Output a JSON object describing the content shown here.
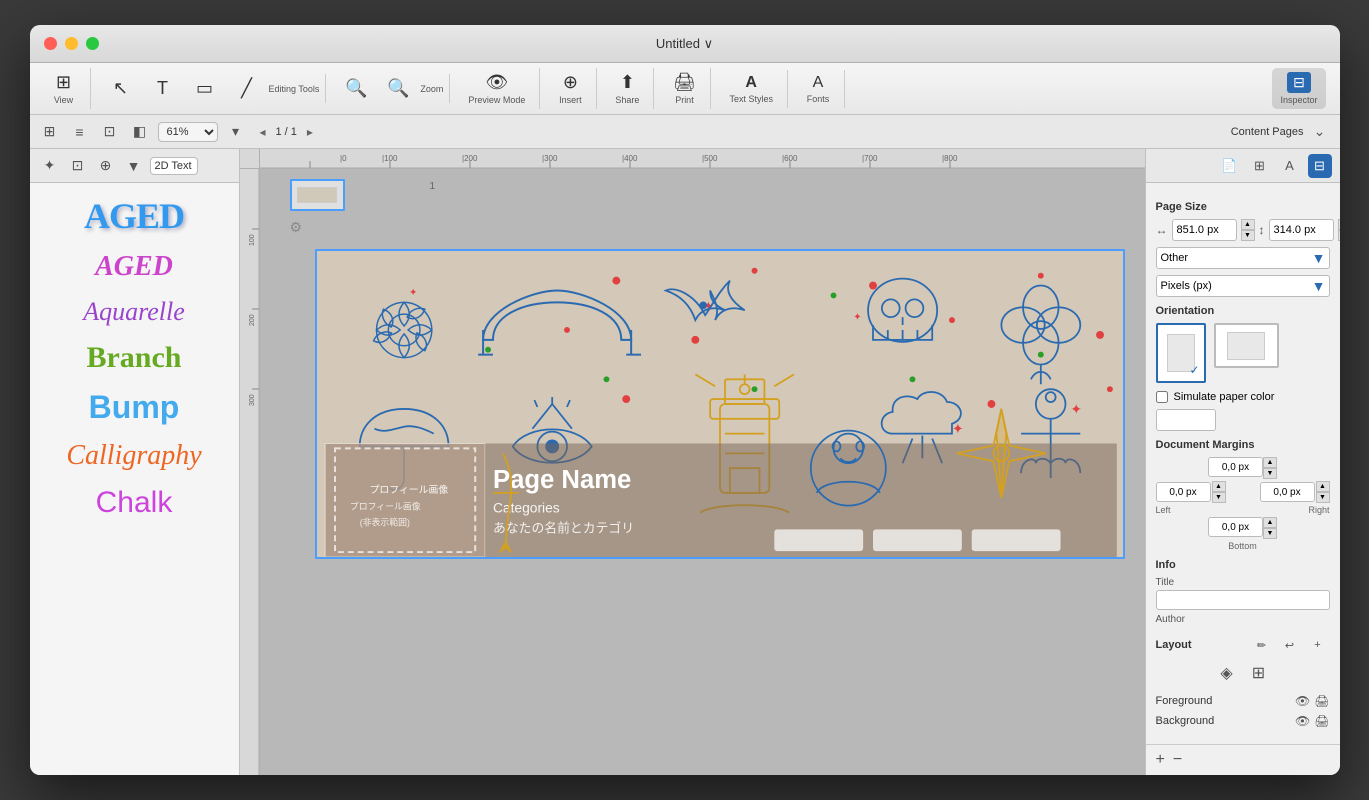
{
  "window": {
    "title": "Untitled ∨"
  },
  "toolbar": {
    "view_label": "View",
    "editing_tools_label": "Editing Tools",
    "zoom_label": "Zoom",
    "preview_mode_label": "Preview Mode",
    "insert_label": "Insert",
    "share_label": "Share",
    "print_label": "Print",
    "text_styles_label": "Text Styles",
    "fonts_label": "Fonts",
    "inspector_label": "Inspector"
  },
  "subtoolbar": {
    "zoom_value": "61%",
    "page_current": "1",
    "page_total": "1",
    "content_pages": "Content Pages"
  },
  "sidebar": {
    "category": "2D Text",
    "styles": [
      {
        "name": "AGED",
        "style": "aged-blue"
      },
      {
        "name": "AGED",
        "style": "aged-pink"
      },
      {
        "name": "Aquarelle",
        "style": "aquarelle"
      },
      {
        "name": "Branch",
        "style": "branch"
      },
      {
        "name": "Bump",
        "style": "bump"
      },
      {
        "name": "Calligraphy",
        "style": "calligraphy"
      },
      {
        "name": "Chalk",
        "style": "chalk"
      }
    ]
  },
  "canvas": {
    "page_name": "Page Name",
    "categories": "Categories",
    "name_jp": "あなたの名前とカテゴリ",
    "profile_label": "プロフィール画像",
    "profile_sub": "(非表示範囲)"
  },
  "inspector": {
    "title": "Inspector",
    "page_size_label": "Page Size",
    "width_value": "851.0 px",
    "height_value": "314.0 px",
    "size_preset": "Other",
    "units": "Pixels (px)",
    "orientation_label": "Orientation",
    "simulate_paper_label": "Simulate paper color",
    "margins_label": "Document Margins",
    "margin_top": "0,0 px",
    "margin_left": "0,0 px",
    "margin_right": "0,0 px",
    "margin_bottom": "0,0 px",
    "info_label": "Info",
    "title_label": "Title",
    "title_value": "",
    "author_label": "Author",
    "layout_label": "Layout",
    "foreground_label": "Foreground",
    "background_label": "Background"
  }
}
